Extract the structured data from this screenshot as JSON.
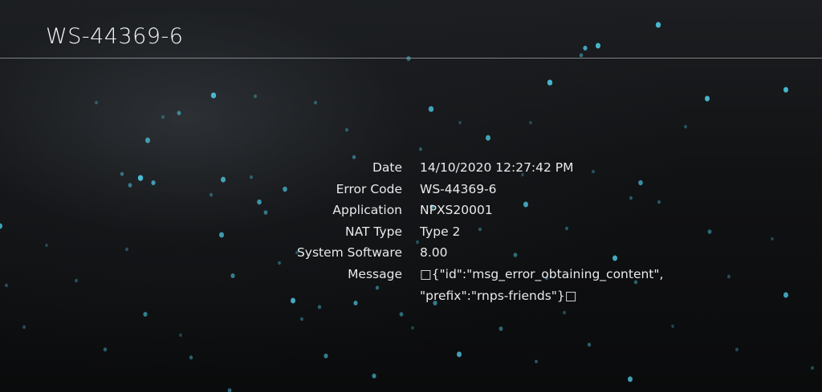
{
  "header": {
    "title": "WS-44369-6"
  },
  "details": [
    {
      "label": "Date",
      "value": "14/10/2020  12:27:42 PM"
    },
    {
      "label": "Error Code",
      "value": "WS-44369-6"
    },
    {
      "label": "Application",
      "value": "NPXS20001"
    },
    {
      "label": "NAT Type",
      "value": "Type 2"
    },
    {
      "label": "System Software",
      "value": "8.00"
    },
    {
      "label": "Message",
      "value": "□{\"id\":\"msg_error_obtaining_content\",\n\"prefix\":\"rnps-friends\"}□"
    }
  ],
  "colors": {
    "background": "#0a0b0d",
    "particle": "#4cc6e0",
    "text": "#e8eaec"
  }
}
